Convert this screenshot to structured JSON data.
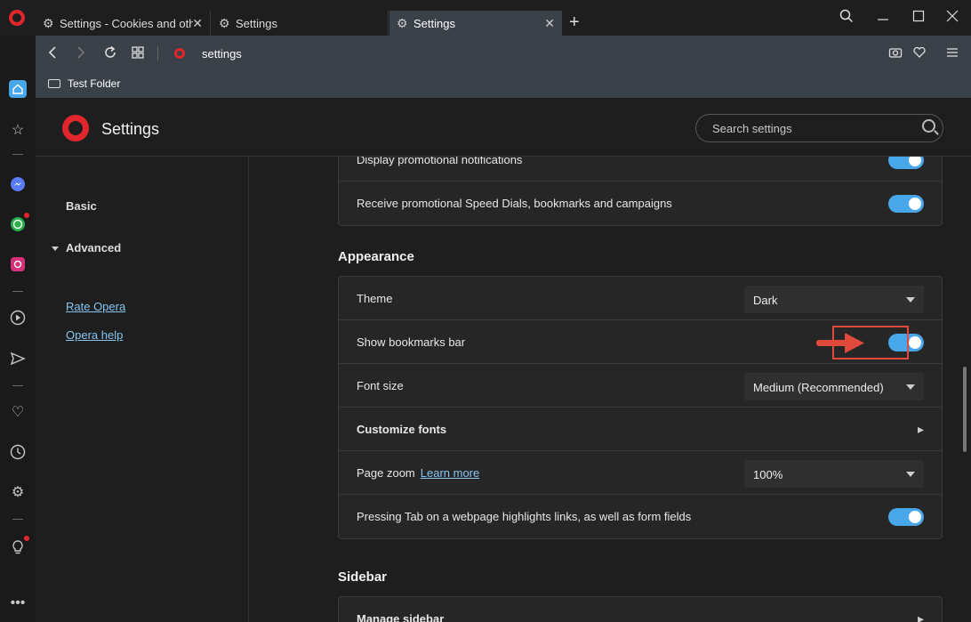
{
  "tabs": [
    {
      "title": "Settings - Cookies and othe",
      "active": false
    },
    {
      "title": "Settings",
      "active": false
    },
    {
      "title": "Settings",
      "active": true
    }
  ],
  "address": {
    "url": "settings"
  },
  "bookmarks_bar": {
    "folder": "Test Folder"
  },
  "page": {
    "title": "Settings",
    "search_placeholder": "Search settings"
  },
  "nav": {
    "basic": "Basic",
    "advanced": "Advanced",
    "rate": "Rate Opera",
    "help": "Opera help"
  },
  "promo_card": {
    "row1": "Display promotional notifications",
    "row2": "Receive promotional Speed Dials, bookmarks and campaigns"
  },
  "appearance": {
    "title": "Appearance",
    "theme_label": "Theme",
    "theme_value": "Dark",
    "bookmarks_label": "Show bookmarks bar",
    "font_size_label": "Font size",
    "font_size_value": "Medium (Recommended)",
    "customize_fonts": "Customize fonts",
    "page_zoom_label": "Page zoom",
    "learn_more": "Learn more",
    "page_zoom_value": "100%",
    "tab_highlight": "Pressing Tab on a webpage highlights links, as well as form fields"
  },
  "sidebar_section": {
    "title": "Sidebar",
    "manage": "Manage sidebar"
  },
  "colors": {
    "accent": "#48a7e8",
    "opera_red": "#e0262d",
    "highlight": "#e04a3c"
  }
}
